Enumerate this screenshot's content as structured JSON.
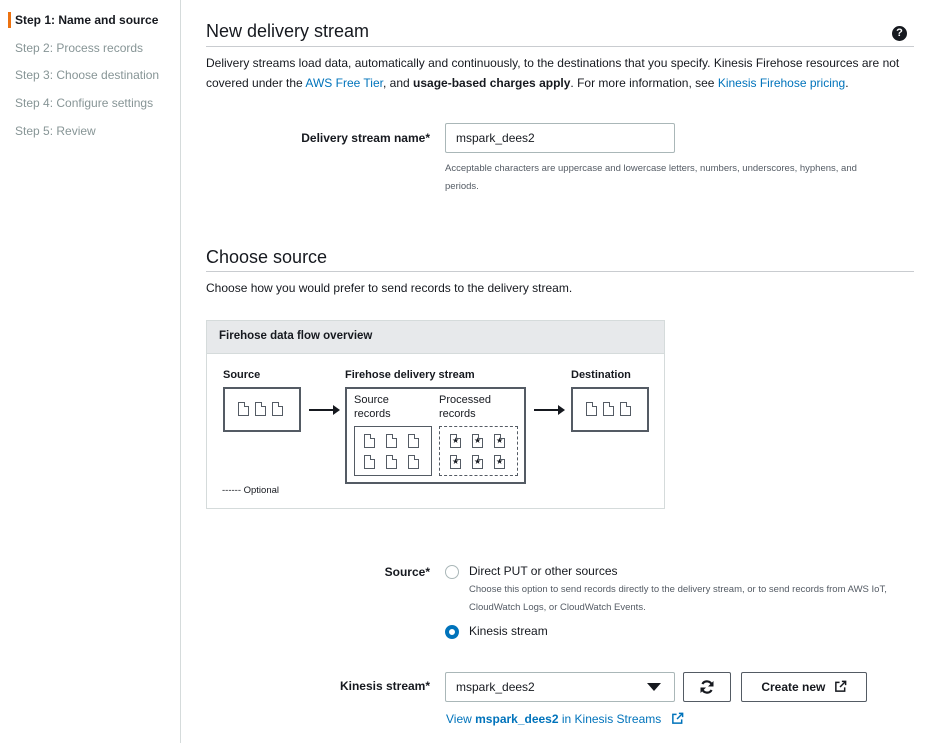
{
  "sidebar": {
    "steps": [
      {
        "label": "Step 1: Name and source"
      },
      {
        "label": "Step 2: Process records"
      },
      {
        "label": "Step 3: Choose destination"
      },
      {
        "label": "Step 4: Configure settings"
      },
      {
        "label": "Step 5: Review"
      }
    ]
  },
  "section1": {
    "title": "New delivery stream",
    "desc_part1": "Delivery streams load data, automatically and continuously, to the destinations that you specify. Kinesis Firehose resources are not covered under the ",
    "free_tier_link": "AWS Free Tier",
    "desc_part2": ", and ",
    "desc_bold": "usage-based charges apply",
    "desc_part3": ". For more information, see ",
    "pricing_link": "Kinesis Firehose pricing",
    "desc_part4": ".",
    "name_label": "Delivery stream name*",
    "name_value": "mspark_dees2",
    "name_hint": "Acceptable characters are uppercase and lowercase letters, numbers, underscores, hyphens, and periods."
  },
  "section2": {
    "title": "Choose source",
    "desc": "Choose how you would prefer to send records to the delivery stream."
  },
  "diagram": {
    "title": "Firehose data flow overview",
    "source": "Source",
    "stream": "Firehose delivery stream",
    "destination": "Destination",
    "source_records_1": "Source",
    "source_records_2": "records",
    "processed_records_1": "Processed",
    "processed_records_2": "records",
    "legend": "------ Optional"
  },
  "source_field": {
    "label": "Source*",
    "options": [
      {
        "label": "Direct PUT or other sources",
        "desc": "Choose this option to send records directly to the delivery stream, or to send records from AWS IoT, CloudWatch Logs, or CloudWatch Events.",
        "selected": false
      },
      {
        "label": "Kinesis stream",
        "selected": true
      }
    ]
  },
  "kinesis_field": {
    "label": "Kinesis stream*",
    "value": "mspark_dees2",
    "refresh_icon": "refresh-icon",
    "create_label": "Create new",
    "link_prefix": "View ",
    "link_name": "mspark_dees2",
    "link_suffix": " in Kinesis Streams"
  },
  "colors": {
    "accent": "#ec7211",
    "link": "#0073bb",
    "radio": "#0073bb",
    "text": "#16191f"
  }
}
